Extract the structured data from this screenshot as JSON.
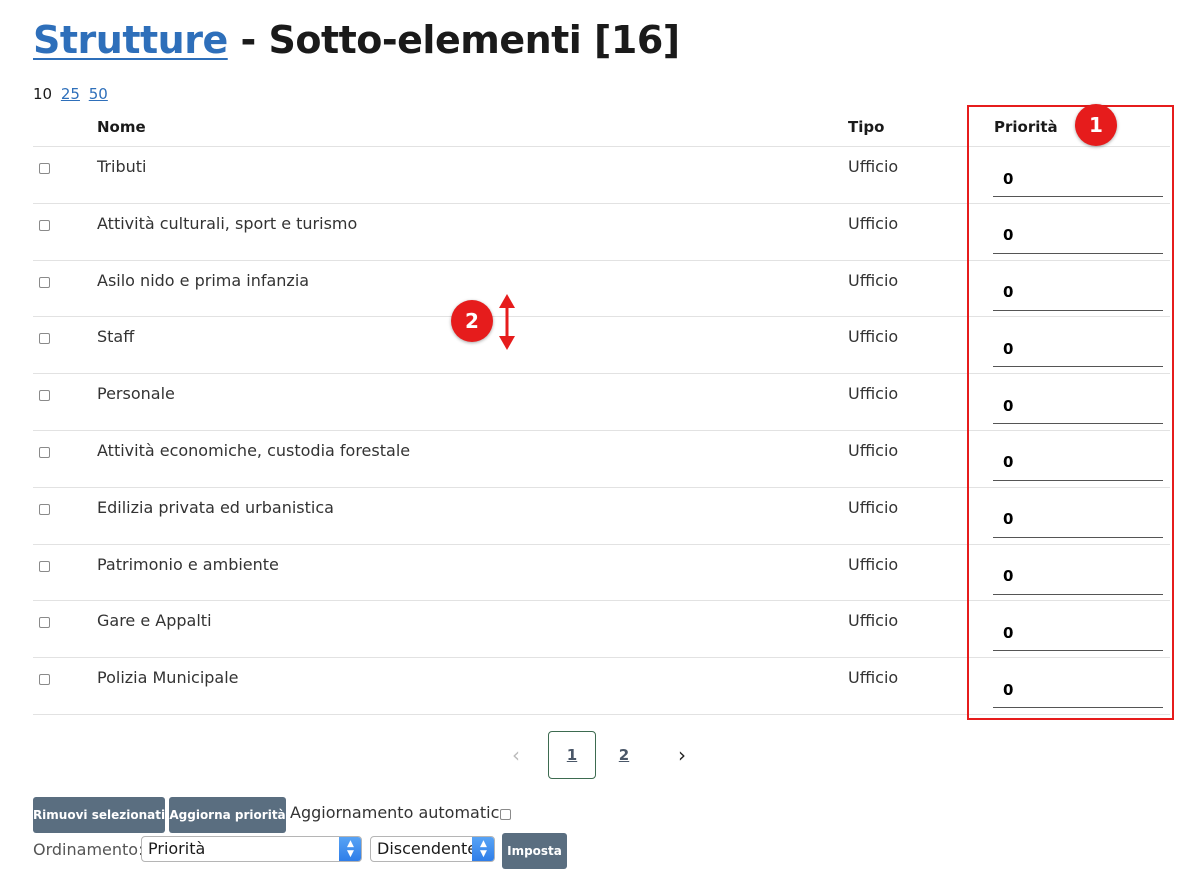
{
  "header": {
    "title_link": "Strutture",
    "title_rest": " - Sotto-elementi [16]"
  },
  "page_size": {
    "current": "10",
    "options": [
      "25",
      "50"
    ]
  },
  "table": {
    "columns": {
      "nome": "Nome",
      "tipo": "Tipo",
      "priorita": "Priorità"
    },
    "rows": [
      {
        "nome": "Tributi",
        "tipo": "Ufficio",
        "priorita": "0"
      },
      {
        "nome": "Attività culturali, sport e turismo",
        "tipo": "Ufficio",
        "priorita": "0"
      },
      {
        "nome": "Asilo nido e prima infanzia",
        "tipo": "Ufficio",
        "priorita": "0"
      },
      {
        "nome": "Staff",
        "tipo": "Ufficio",
        "priorita": "0"
      },
      {
        "nome": "Personale",
        "tipo": "Ufficio",
        "priorita": "0"
      },
      {
        "nome": "Attività economiche, custodia forestale",
        "tipo": "Ufficio",
        "priorita": "0"
      },
      {
        "nome": "Edilizia privata ed urbanistica",
        "tipo": "Ufficio",
        "priorita": "0"
      },
      {
        "nome": "Patrimonio e ambiente",
        "tipo": "Ufficio",
        "priorita": "0"
      },
      {
        "nome": "Gare e Appalti",
        "tipo": "Ufficio",
        "priorita": "0"
      },
      {
        "nome": "Polizia Municipale",
        "tipo": "Ufficio",
        "priorita": "0"
      }
    ]
  },
  "annotations": {
    "badge_1": "1",
    "badge_2": "2",
    "color": "#e61c1c"
  },
  "pagination": {
    "prev_icon": "chevron-left-icon",
    "next_icon": "chevron-right-icon",
    "prev": "‹",
    "next": "›",
    "pages": [
      "1",
      "2"
    ],
    "active": "1"
  },
  "actions": {
    "remove_label": "Rimuovi selezionati",
    "update_label": "Aggiorna priorità",
    "auto_update_label": "Aggiornamento automatico",
    "order_label": "Ordinamento:",
    "order_field": "Priorità",
    "order_direction": "Discendente",
    "set_label": "Imposta"
  },
  "colors": {
    "link": "#2e6fba",
    "button": "#5a6e80",
    "highlight": "#e61c1c"
  }
}
